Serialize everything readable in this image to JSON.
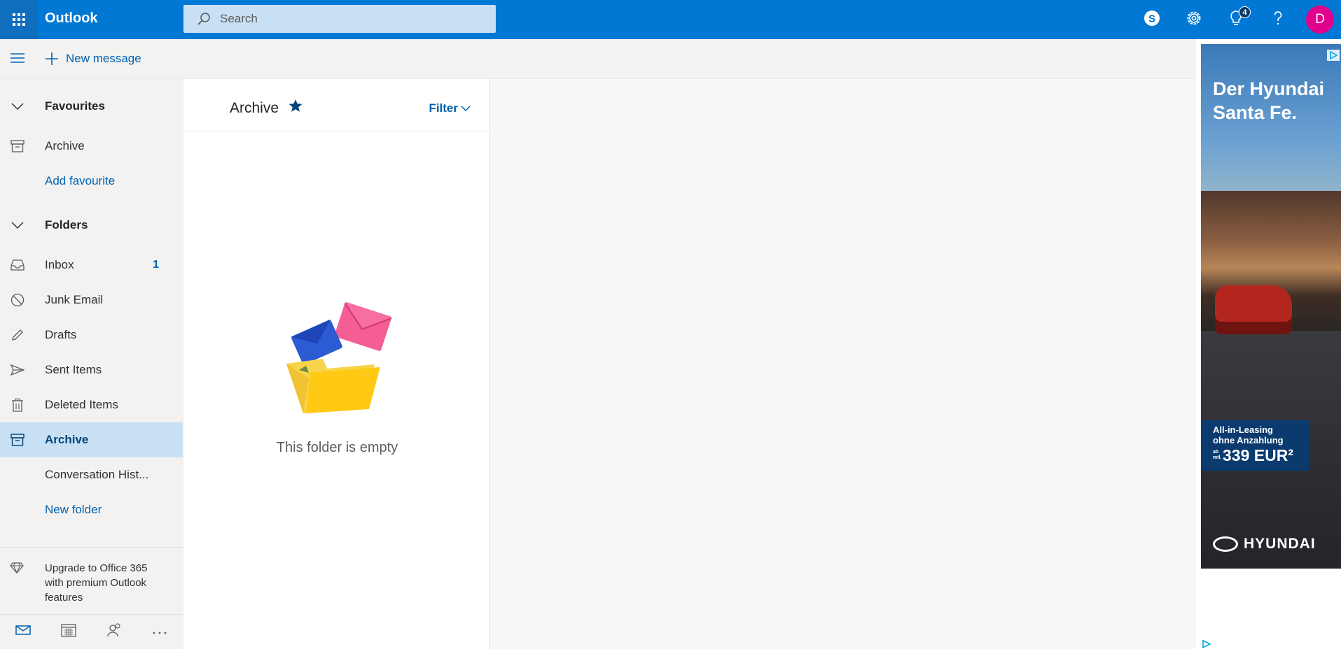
{
  "app": {
    "brand": "Outlook",
    "accent_color": "#0078d4",
    "search_placeholder": "Search",
    "top_icons": [
      "skype-icon",
      "gear-icon",
      "lightbulb-icon",
      "help-icon"
    ],
    "whats_new_badge": "4",
    "avatar_initial": "D",
    "avatar_color": "#e3008c"
  },
  "command_bar": {
    "new_message_label": "New message"
  },
  "sidebar": {
    "favourites_header": "Favourites",
    "favourites_items": [
      {
        "label": "Archive",
        "icon": "archive-icon"
      }
    ],
    "add_favourite_label": "Add favourite",
    "folders_header": "Folders",
    "folders": [
      {
        "label": "Inbox",
        "icon": "inbox-icon",
        "count": "1"
      },
      {
        "label": "Junk Email",
        "icon": "blocked-icon"
      },
      {
        "label": "Drafts",
        "icon": "pencil-icon"
      },
      {
        "label": "Sent Items",
        "icon": "send-icon"
      },
      {
        "label": "Deleted Items",
        "icon": "trash-icon"
      },
      {
        "label": "Archive",
        "icon": "archive-icon",
        "selected": true
      },
      {
        "label": "Conversation Hist...",
        "icon": ""
      }
    ],
    "new_folder_label": "New folder",
    "upgrade_text": "Upgrade to Office 365 with premium Outlook features",
    "bottom_nav": [
      "mail-icon",
      "calendar-icon",
      "people-icon",
      "more-icon"
    ]
  },
  "message_list": {
    "title": "Archive",
    "filter_label": "Filter",
    "empty_text": "This folder is empty"
  },
  "ad": {
    "headline": "Der Hyundai Santa Fe.",
    "offer_line1": "All-in-Leasing",
    "offer_line2": "ohne Anzahlung",
    "offer_prefix": "ab mtl.",
    "offer_price": "339 EUR²",
    "brand": "HYUNDAI"
  }
}
